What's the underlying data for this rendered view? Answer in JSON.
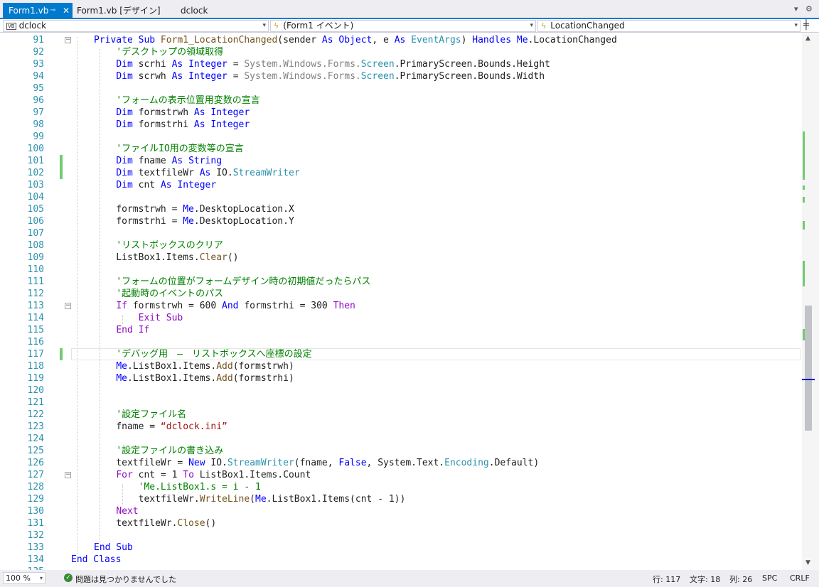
{
  "tabs": [
    {
      "label": "Form1.vb",
      "active": true
    },
    {
      "label": "Form1.vb [デザイン]",
      "active": false
    },
    {
      "label": "dclock",
      "active": false
    }
  ],
  "nav": {
    "project": "dclock",
    "object": "(Form1 イベント)",
    "member": "LocationChanged"
  },
  "editor": {
    "lines": [
      {
        "num": "91",
        "html": "<span class=\"kw\">Private Sub</span> <span class=\"fn\">Form1_LocationChanged</span>(sender <span class=\"kw\">As Object</span>, e <span class=\"kw\">As</span> <span class=\"ty\">EventArgs</span>) <span class=\"kw\">Handles Me</span>.LocationChanged"
      },
      {
        "num": "92",
        "html": "    <span class=\"cm\">'デスクトップの領域取得</span>"
      },
      {
        "num": "93",
        "html": "    <span class=\"kw\">Dim</span> scrhi <span class=\"kw\">As Integer</span> = <span class=\"dim\">System.Windows.Forms.</span><span class=\"ty\">Screen</span>.PrimaryScreen.Bounds.Height"
      },
      {
        "num": "94",
        "html": "    <span class=\"kw\">Dim</span> scrwh <span class=\"kw\">As Integer</span> = <span class=\"dim\">System.Windows.Forms.</span><span class=\"ty\">Screen</span>.PrimaryScreen.Bounds.Width"
      },
      {
        "num": "95",
        "html": ""
      },
      {
        "num": "96",
        "html": "    <span class=\"cm\">'フォームの表示位置用変数の宣言</span>"
      },
      {
        "num": "97",
        "html": "    <span class=\"kw\">Dim</span> formstrwh <span class=\"kw\">As Integer</span>"
      },
      {
        "num": "98",
        "html": "    <span class=\"kw\">Dim</span> formstrhi <span class=\"kw\">As Integer</span>"
      },
      {
        "num": "99",
        "html": ""
      },
      {
        "num": "100",
        "html": "    <span class=\"cm\">'ファイルIO用の変数等の宣言</span>"
      },
      {
        "num": "101",
        "html": "    <span class=\"kw\">Dim</span> fname <span class=\"kw\">As String</span>"
      },
      {
        "num": "102",
        "html": "    <span class=\"kw\">Dim</span> textfileWr <span class=\"kw\">As</span> IO.<span class=\"ty\">StreamWriter</span>"
      },
      {
        "num": "103",
        "html": "    <span class=\"kw\">Dim</span> cnt <span class=\"kw\">As Integer</span>"
      },
      {
        "num": "104",
        "html": ""
      },
      {
        "num": "105",
        "html": "    formstrwh = <span class=\"kw\">Me</span>.DesktopLocation.X"
      },
      {
        "num": "106",
        "html": "    formstrhi = <span class=\"kw\">Me</span>.DesktopLocation.Y"
      },
      {
        "num": "107",
        "html": ""
      },
      {
        "num": "108",
        "html": "    <span class=\"cm\">'リストボックスのクリア</span>"
      },
      {
        "num": "109",
        "html": "    ListBox1.Items.<span class=\"fn\">Clear</span>()"
      },
      {
        "num": "110",
        "html": ""
      },
      {
        "num": "111",
        "html": "    <span class=\"cm\">'フォームの位置がフォームデザイン時の初期値だったらパス</span>"
      },
      {
        "num": "112",
        "html": "    <span class=\"cm\">'起動時のイベントのパス</span>"
      },
      {
        "num": "113",
        "html": "    <span class=\"ctl\">If</span> formstrwh = 600 <span class=\"kw\">And</span> formstrhi = 300 <span class=\"ctl\">Then</span>"
      },
      {
        "num": "114",
        "html": "        <span class=\"ctl\">Exit Sub</span>"
      },
      {
        "num": "115",
        "html": "    <span class=\"ctl\">End If</span>"
      },
      {
        "num": "116",
        "html": ""
      },
      {
        "num": "117",
        "html": "    <span class=\"cm\">'デバッグ用　—　リストボックスへ座標の設定</span>"
      },
      {
        "num": "118",
        "html": "    <span class=\"kw\">Me</span>.ListBox1.Items.<span class=\"fn\">Add</span>(formstrwh)"
      },
      {
        "num": "119",
        "html": "    <span class=\"kw\">Me</span>.ListBox1.Items.<span class=\"fn\">Add</span>(formstrhi)"
      },
      {
        "num": "120",
        "html": ""
      },
      {
        "num": "121",
        "html": ""
      },
      {
        "num": "122",
        "html": "    <span class=\"cm\">'設定ファイル名</span>"
      },
      {
        "num": "123",
        "html": "    fname = <span class=\"st\">“dclock.ini”</span>"
      },
      {
        "num": "124",
        "html": ""
      },
      {
        "num": "125",
        "html": "    <span class=\"cm\">'設定ファイルの書き込み</span>"
      },
      {
        "num": "126",
        "html": "    textfileWr = <span class=\"kw\">New</span> IO.<span class=\"ty\">StreamWriter</span>(fname, <span class=\"kw\">False</span>, System.Text.<span class=\"ty\">Encoding</span>.Default)"
      },
      {
        "num": "127",
        "html": "    <span class=\"ctl\">For</span> cnt = 1 <span class=\"ctl\">To</span> ListBox1.Items.Count"
      },
      {
        "num": "128",
        "html": "        <span class=\"cm\">'Me.ListBox1.s = i - 1</span>"
      },
      {
        "num": "129",
        "html": "        textfileWr.<span class=\"fn\">WriteLine</span>(<span class=\"kw\">Me</span>.ListBox1.Items(cnt - 1))"
      },
      {
        "num": "130",
        "html": "    <span class=\"ctl\">Next</span>"
      },
      {
        "num": "131",
        "html": "    textfileWr.<span class=\"fn\">Close</span>()"
      },
      {
        "num": "132",
        "html": ""
      },
      {
        "num": "133",
        "html": "<span class=\"kw\">End Sub</span>"
      },
      {
        "num": "134",
        "html": "<span class=\"kw\">End Class</span>"
      },
      {
        "num": "135",
        "html": ""
      }
    ]
  },
  "status": {
    "zoom": "100 %",
    "message": "問題は見つかりませんでした",
    "line": "行: 117",
    "char": "文字: 18",
    "col": "列: 26",
    "spc": "SPC",
    "crlf": "CRLF"
  },
  "colors": {
    "accent": "#007acc",
    "keyword": "#0000ff",
    "type": "#2b91af",
    "comment": "#008000",
    "change_mark": "#6fcc6f"
  }
}
